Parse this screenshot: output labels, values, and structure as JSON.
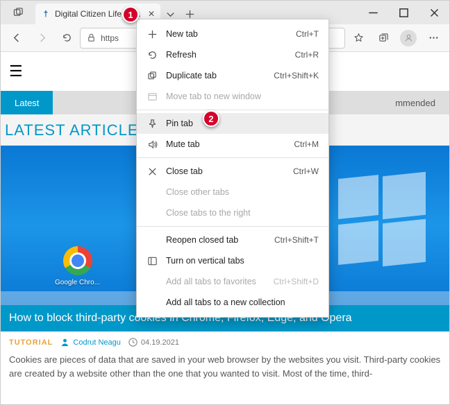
{
  "browser": {
    "tab_title": "Digital Citizen Life in a...",
    "url_scheme": "https"
  },
  "toolbar_right_spacer": "",
  "context_menu": {
    "items": [
      {
        "icon": "plus",
        "label": "New tab",
        "shortcut": "Ctrl+T",
        "disabled": false
      },
      {
        "icon": "refresh",
        "label": "Refresh",
        "shortcut": "Ctrl+R",
        "disabled": false
      },
      {
        "icon": "duplicate",
        "label": "Duplicate tab",
        "shortcut": "Ctrl+Shift+K",
        "disabled": false
      },
      {
        "icon": "window",
        "label": "Move tab to new window",
        "shortcut": "",
        "disabled": true
      },
      {
        "sep": true
      },
      {
        "icon": "pin",
        "label": "Pin tab",
        "shortcut": "",
        "disabled": false,
        "highlight": true
      },
      {
        "icon": "mute",
        "label": "Mute tab",
        "shortcut": "Ctrl+M",
        "disabled": false
      },
      {
        "sep": true
      },
      {
        "icon": "close",
        "label": "Close tab",
        "shortcut": "Ctrl+W",
        "disabled": false
      },
      {
        "icon": "",
        "label": "Close other tabs",
        "shortcut": "",
        "disabled": true
      },
      {
        "icon": "",
        "label": "Close tabs to the right",
        "shortcut": "",
        "disabled": true
      },
      {
        "sep": true
      },
      {
        "icon": "",
        "label": "Reopen closed tab",
        "shortcut": "Ctrl+Shift+T",
        "disabled": false
      },
      {
        "icon": "vertical",
        "label": "Turn on vertical tabs",
        "shortcut": "",
        "disabled": false
      },
      {
        "icon": "",
        "label": "Add all tabs to favorites",
        "shortcut": "Ctrl+Shift+D",
        "disabled": true
      },
      {
        "icon": "",
        "label": "Add all tabs to a new collection",
        "shortcut": "",
        "disabled": false
      }
    ]
  },
  "callouts": {
    "one": "1",
    "two": "2"
  },
  "site": {
    "nav": {
      "latest": "Latest",
      "recommended": "mmended"
    },
    "section_title": "LATEST ARTICLES",
    "chrome_label": "Google Chro...",
    "article": {
      "title": "How to block third-party cookies in Chrome, Firefox, Edge, and Opera",
      "tag": "TUTORIAL",
      "author": "Codrut Neagu",
      "date": "04.19.2021",
      "body": "Cookies are pieces of data that are saved in your web browser by the websites you visit. Third-party cookies are created by a website other than the one that you wanted to visit. Most of the time, third-"
    }
  }
}
